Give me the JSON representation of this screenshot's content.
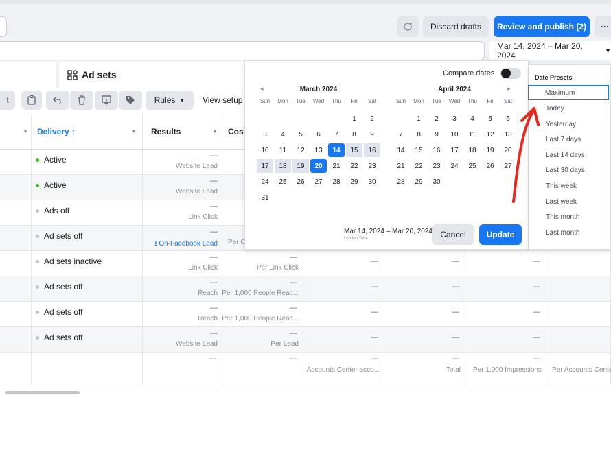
{
  "toolbar_top": {
    "discard_label": "Discard drafts",
    "review_label": "Review and publish (2)",
    "more_label": "···"
  },
  "date_selector": {
    "range_label": "Mar 14, 2024 – Mar 20, 2024",
    "dropdown_icon": "caret-down-icon"
  },
  "tabs": {
    "adsets_label": "Ad sets"
  },
  "toolbar": {
    "rules_label": "Rules",
    "view_setup_label": "View setup"
  },
  "table": {
    "headers": {
      "delivery": "Delivery ↑",
      "results": "Results",
      "cost": "Cost"
    },
    "rows": [
      {
        "delivery": "Active",
        "status_color": "#42b72a",
        "results_dash": "—",
        "results_sub": "Website Lead",
        "cost_dash": "",
        "cost_sub": "",
        "c4": "",
        "c5": "",
        "c6": ""
      },
      {
        "delivery": "Active",
        "status_color": "#42b72a",
        "results_dash": "—",
        "results_sub": "Website Lead",
        "cost_dash": "",
        "cost_sub": "",
        "c4": "",
        "c5": "",
        "c6": ""
      },
      {
        "delivery": "Ads off",
        "status_color": "#bec3c9",
        "results_dash": "—",
        "results_sub": "Link Click",
        "cost_dash": "",
        "cost_sub": "",
        "c4": "",
        "c5": "",
        "c6": ""
      },
      {
        "delivery": "Ad sets off",
        "status_color": "#bec3c9",
        "results_dash": "—",
        "results_sub": "On-Facebook Lead",
        "cost_dash": "",
        "cost_sub": "Per C",
        "c4": "",
        "c5": "",
        "c6": ""
      },
      {
        "delivery": "Ad sets inactive",
        "status_color": "#bec3c9",
        "results_dash": "—",
        "results_sub": "Link Click",
        "cost_dash": "—",
        "cost_sub": "Per Link Click",
        "c4": "—",
        "c5": "—",
        "c6": "—"
      },
      {
        "delivery": "Ad sets off",
        "status_color": "#bec3c9",
        "results_dash": "—",
        "results_sub": "Reach",
        "cost_dash": "—",
        "cost_sub": "Per 1,000 People Reac...",
        "c4": "—",
        "c5": "—",
        "c6": "—"
      },
      {
        "delivery": "Ad sets off",
        "status_color": "#bec3c9",
        "results_dash": "—",
        "results_sub": "Reach",
        "cost_dash": "—",
        "cost_sub": "Per 1,000 People Reac...",
        "c4": "—",
        "c5": "—",
        "c6": "—"
      },
      {
        "delivery": "Ad sets off",
        "status_color": "#bec3c9",
        "results_dash": "—",
        "results_sub": "Website Lead",
        "cost_dash": "—",
        "cost_sub": "Per Lead",
        "c4": "—",
        "c5": "—",
        "c6": "—"
      }
    ],
    "summary": {
      "results_dash": "—",
      "cost_dash": "—",
      "c4_dash": "—",
      "c4_sub": "Accounts Center acco...",
      "c5_dash": "—",
      "c5_sub": "Total",
      "c6_dash": "—",
      "c6_sub": "Per 1,000 Impressions",
      "c7_sub": "Per Accounts Center"
    }
  },
  "calendar": {
    "compare_label": "Compare dates",
    "months": [
      {
        "title": "March 2024",
        "dow": [
          "Sun",
          "Mon",
          "Tue",
          "Wed",
          "Thu",
          "Fri",
          "Sat"
        ],
        "weeks": [
          [
            "",
            "",
            "",
            "",
            "",
            "1",
            "2"
          ],
          [
            "3",
            "4",
            "5",
            "6",
            "7",
            "8",
            "9"
          ],
          [
            "10",
            "11",
            "12",
            "13",
            "14",
            "15",
            "16"
          ],
          [
            "17",
            "18",
            "19",
            "20",
            "21",
            "22",
            "23"
          ],
          [
            "24",
            "25",
            "26",
            "27",
            "28",
            "29",
            "30"
          ],
          [
            "31",
            "",
            "",
            "",
            "",
            "",
            ""
          ]
        ]
      },
      {
        "title": "April 2024",
        "dow": [
          "Sun",
          "Mon",
          "Tue",
          "Wed",
          "Thu",
          "Fri",
          "Sat"
        ],
        "weeks": [
          [
            "",
            "1",
            "2",
            "3",
            "4",
            "5",
            "6"
          ],
          [
            "7",
            "8",
            "9",
            "10",
            "11",
            "12",
            "13"
          ],
          [
            "14",
            "15",
            "16",
            "17",
            "18",
            "19",
            "20"
          ],
          [
            "21",
            "22",
            "23",
            "24",
            "25",
            "26",
            "27"
          ],
          [
            "28",
            "29",
            "30",
            "",
            "",
            "",
            ""
          ]
        ]
      }
    ],
    "selected_range_label": "Mar 14, 2024 – Mar 20, 2024",
    "timezone_label": "London Time",
    "cancel_label": "Cancel",
    "update_label": "Update"
  },
  "presets": {
    "title": "Date Presets",
    "items": [
      "Maximum",
      "Today",
      "Yesterday",
      "Last 7 days",
      "Last 14 days",
      "Last 30 days",
      "This week",
      "Last week",
      "This month",
      "Last month"
    ]
  },
  "colors": {
    "accent": "#1877f2",
    "annotation": "#e8281c"
  }
}
